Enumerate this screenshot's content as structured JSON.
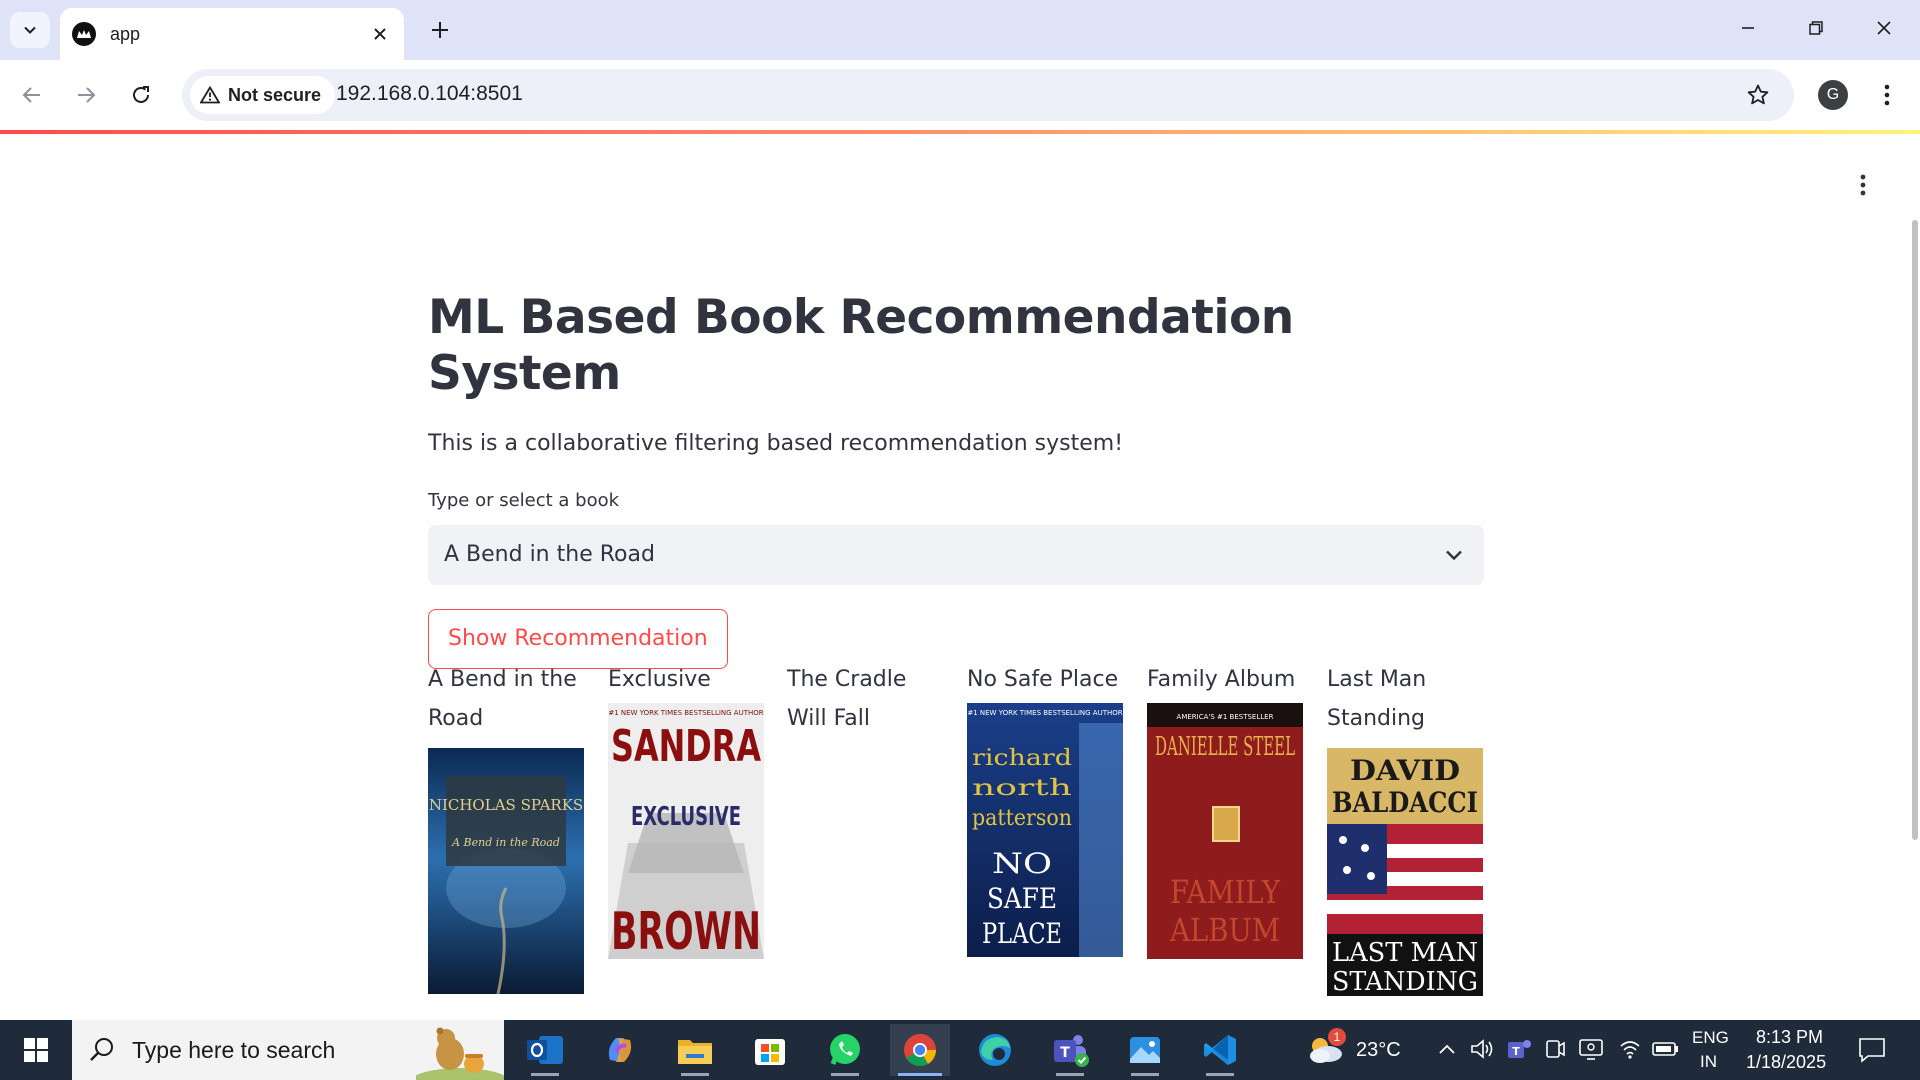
{
  "browser": {
    "tab_title": "app",
    "security_label": "Not secure",
    "url": "192.168.0.104:8501",
    "profile_initial": "G"
  },
  "app": {
    "title": "ML Based Book Recommendation System",
    "subtitle": "This is a collaborative filtering based recommendation system!",
    "select_label": "Type or select a book",
    "selected_book": "A Bend in the Road",
    "button_label": "Show Recommendation",
    "recommendations": [
      {
        "title": "A Bend in the Road",
        "cover_author": "NICHOLAS SPARKS",
        "cover_title": "A Bend in the Road"
      },
      {
        "title": "Exclusive",
        "cover_top": "#1 NEW YORK TIMES BESTSELLING AUTHOR",
        "cover_author_first": "SANDRA",
        "cover_title": "EXCLUSIVE",
        "cover_author_last": "BROWN"
      },
      {
        "title": "The Cradle Will Fall"
      },
      {
        "title": "No Safe Place",
        "cover_top": "#1 NEW YORK TIMES BESTSELLING AUTHOR",
        "cover_author": "richard north patterson",
        "cover_title": "NO SAFE PLACE"
      },
      {
        "title": "Family Album",
        "cover_top": "AMERICA'S #1 BESTSELLER",
        "cover_author": "DANIELLE STEEL",
        "cover_title": "FAMILY ALBUM"
      },
      {
        "title": "Last Man Standing",
        "cover_author": "DAVID BALDACCI",
        "cover_title": "LAST MAN STANDING"
      }
    ]
  },
  "taskbar": {
    "search_placeholder": "Type here to search",
    "weather_temp": "23°C",
    "weather_badge": "1",
    "language": "ENG",
    "region": "IN",
    "time": "8:13 PM",
    "date": "1/18/2025"
  },
  "colors": {
    "accent": "#ff4b4b",
    "text": "#31333f",
    "select_bg": "#f0f2f6",
    "taskbar": "#1f2b3a"
  }
}
